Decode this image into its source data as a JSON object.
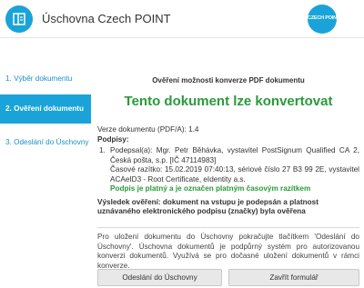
{
  "header": {
    "app_title": "Úschovna Czech POINT",
    "brand_text": "CZECH POINT"
  },
  "sidebar": {
    "items": [
      {
        "label": "1. Výběr dokumentu"
      },
      {
        "label": "2. Ověření dokumentu"
      },
      {
        "label": "3. Odeslání do Úschovny"
      }
    ]
  },
  "main": {
    "subtitle": "Ověření možnosti konverze PDF dokumentu",
    "title": "Tento dokument lze konvertovat",
    "version": "Verze dokumentu (PDF/A): 1.4",
    "signatures_label": "Podpisy:",
    "signature": {
      "number": "1.",
      "signer": "Podepsal(a): Mgr. Petr Běhávka, vystavitel PostSignum Qualified CA 2, Česká pošta, s.p. [IČ 47114983]",
      "timestamp": "Časové razítko: 15.02.2019 07:40:13, sériové číslo 27 B3 99 2E, vystavitel ACAeID3 - Root Certificate, eIdentity a.s.",
      "status": "Podpis je platný a je označen platným časovým razítkem"
    },
    "result": "Výsledek ověření:  dokument na vstupu je podepsán a platnost uznávaného elektronického podpisu (značky) byla ověřena"
  },
  "info": "Pro uložení dokumentu do Úschovny pokračujte tlačítkem 'Odeslání do Úschovny'. Úschovna dokumentů je podpůrný systém pro autorizovanou konverzi dokumentů. Využívá se pro dočasné uložení dokumentů v rámci konverze.",
  "buttons": {
    "send": "Odeslání do Úschovny",
    "close": "Zavřít formulář"
  },
  "colors": {
    "accent": "#1aa3d9",
    "success": "#2a9a3a"
  },
  "icons": {
    "app": "document-icon",
    "brand": "czech-point-logo"
  }
}
